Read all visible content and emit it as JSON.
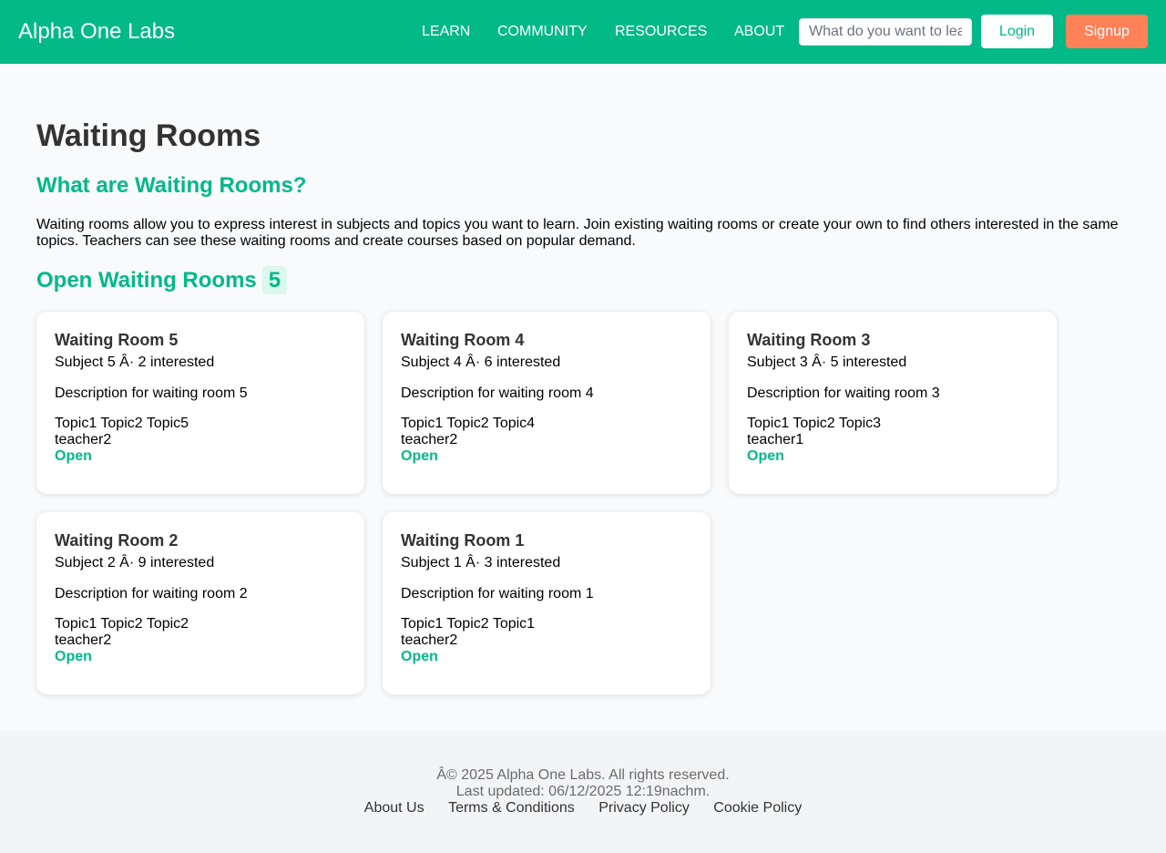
{
  "header": {
    "brand": "Alpha One Labs",
    "nav": [
      "LEARN",
      "COMMUNITY",
      "RESOURCES",
      "ABOUT"
    ],
    "search_placeholder": "What do you want to learn?",
    "login_label": "Login",
    "signup_label": "Signup"
  },
  "main": {
    "title": "Waiting Rooms",
    "what_heading": "What are Waiting Rooms?",
    "intro": "Waiting rooms allow you to express interest in subjects and topics you want to learn. Join existing waiting rooms or create your own to find others interested in the same topics. Teachers can see these waiting rooms and create courses based on popular demand.",
    "open_heading": "Open Waiting Rooms",
    "open_count": "5",
    "rooms": [
      {
        "title": "Waiting Room 5",
        "meta": "Subject 5 Â· 2 interested",
        "description": "Description for waiting room 5",
        "topics": "Topic1 Topic2 Topic5",
        "teacher": "teacher2",
        "status": "Open"
      },
      {
        "title": "Waiting Room 4",
        "meta": "Subject 4 Â· 6 interested",
        "description": "Description for waiting room 4",
        "topics": "Topic1 Topic2 Topic4",
        "teacher": "teacher2",
        "status": "Open"
      },
      {
        "title": "Waiting Room 3",
        "meta": "Subject 3 Â· 5 interested",
        "description": "Description for waiting room 3",
        "topics": "Topic1 Topic2 Topic3",
        "teacher": "teacher1",
        "status": "Open"
      },
      {
        "title": "Waiting Room 2",
        "meta": "Subject 2 Â· 9 interested",
        "description": "Description for waiting room 2",
        "topics": "Topic1 Topic2 Topic2",
        "teacher": "teacher2",
        "status": "Open"
      },
      {
        "title": "Waiting Room 1",
        "meta": "Subject 1 Â· 3 interested",
        "description": "Description for waiting room 1",
        "topics": "Topic1 Topic2 Topic1",
        "teacher": "teacher2",
        "status": "Open"
      }
    ]
  },
  "footer": {
    "copyright": "Â© 2025 Alpha One Labs. All rights reserved.",
    "last_updated": "Last updated: 06/12/2025 12:19nachm.",
    "links": [
      "About Us",
      "Terms & Conditions",
      "Privacy Policy",
      "Cookie Policy"
    ]
  },
  "colors": {
    "brand": "#02b987",
    "signup": "#ff8158",
    "page_bg": "#f8fafc",
    "footer_bg": "#f3f4f6"
  }
}
